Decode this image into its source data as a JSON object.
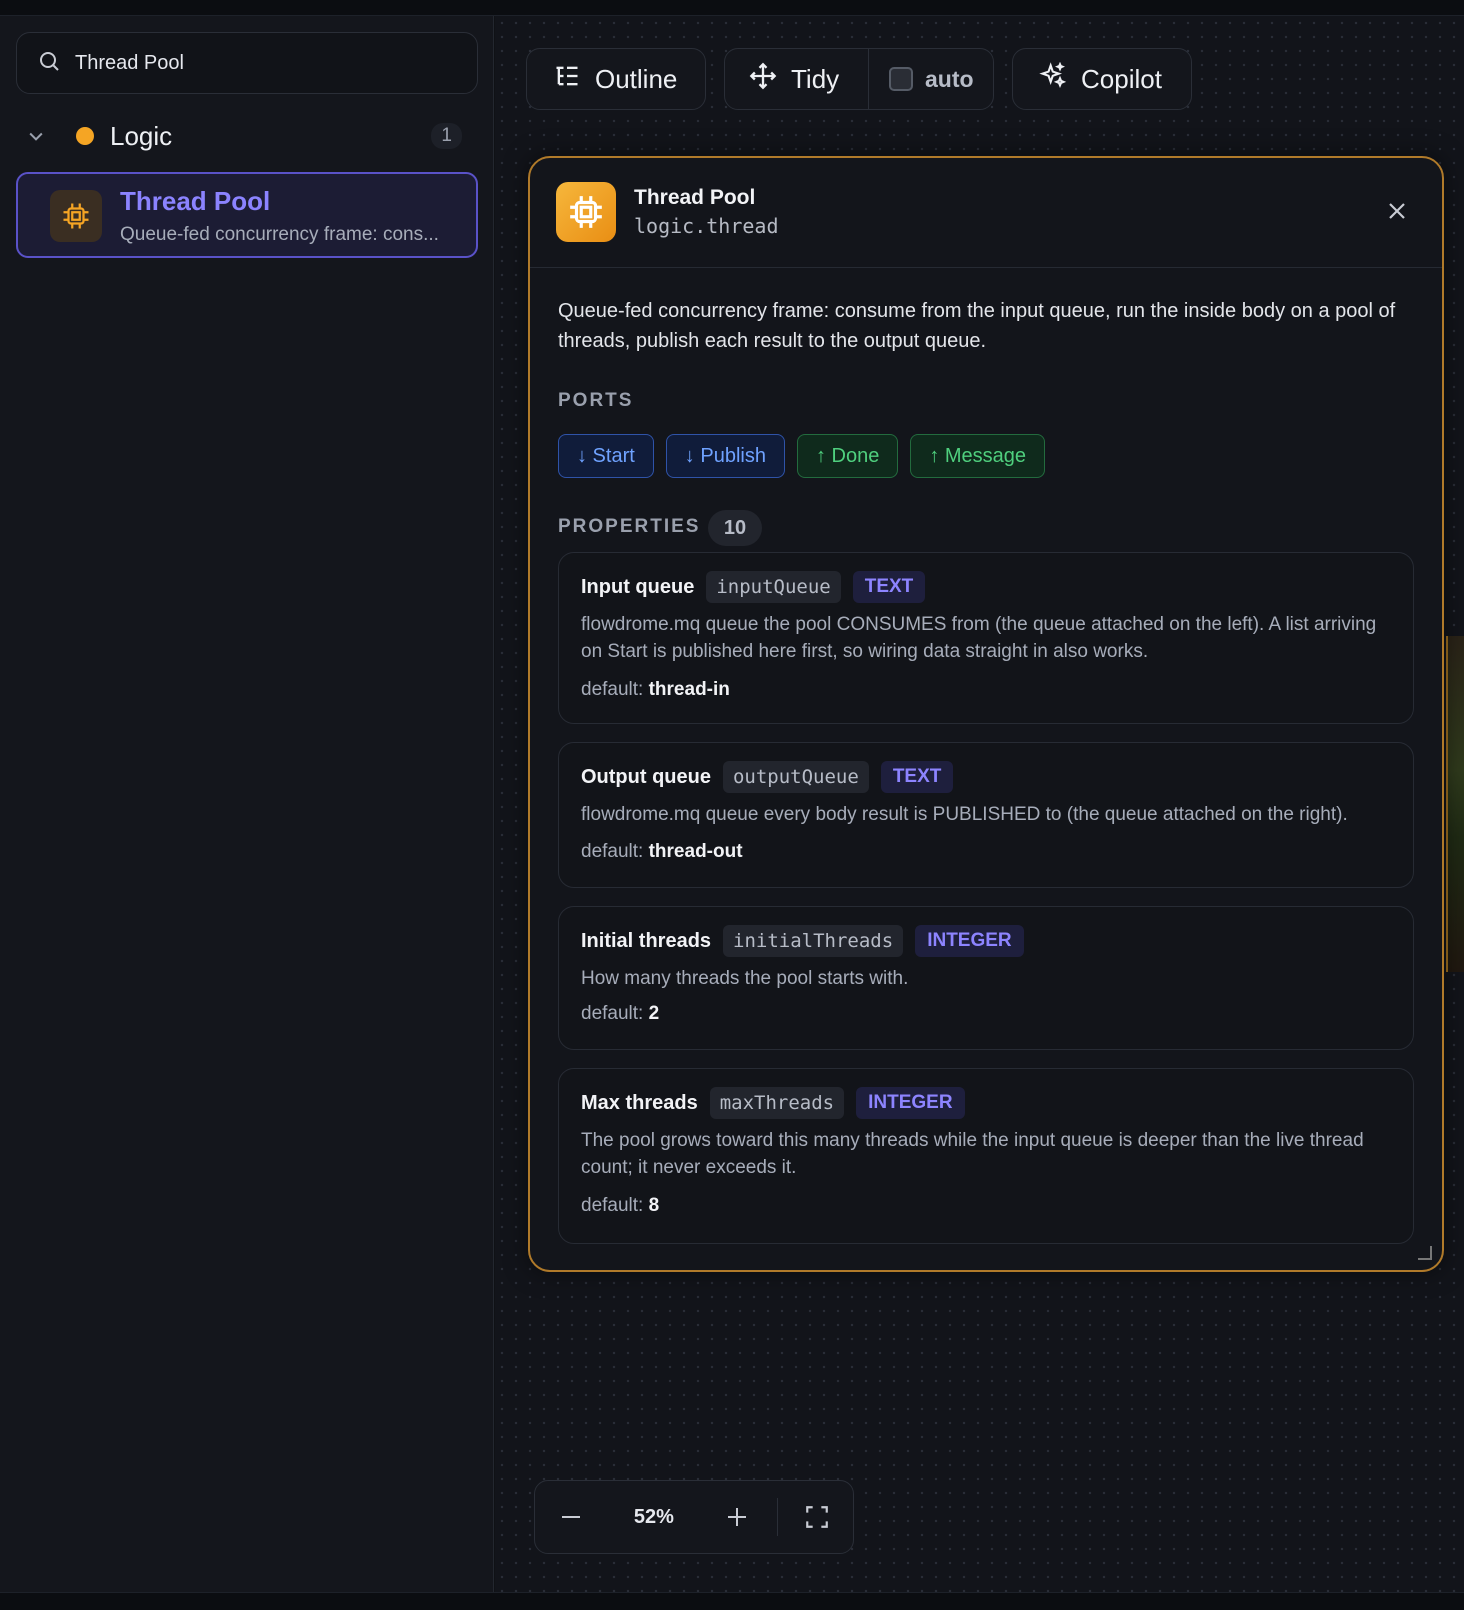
{
  "sidebar": {
    "search": {
      "value": "Thread Pool",
      "icon": "search-icon"
    },
    "group": {
      "label": "Logic",
      "count": "1",
      "dot_color": "#f5a524"
    },
    "item": {
      "title": "Thread Pool",
      "description": "Queue-fed concurrency frame: cons..."
    }
  },
  "toolbar": {
    "outline_label": "Outline",
    "tidy_label": "Tidy",
    "auto_label": "auto",
    "auto_checked": false,
    "copilot_label": "Copilot"
  },
  "panel": {
    "title": "Thread Pool",
    "id": "logic.thread",
    "description": "Queue-fed concurrency frame: consume from the input queue, run the inside body on a pool of threads, publish each result to the output queue.",
    "ports_heading": "PORTS",
    "ports": [
      {
        "label": "↓ Start",
        "direction": "in"
      },
      {
        "label": "↓ Publish",
        "direction": "in"
      },
      {
        "label": "↑ Done",
        "direction": "out"
      },
      {
        "label": "↑ Message",
        "direction": "out"
      }
    ],
    "properties_heading": "PROPERTIES",
    "properties_count": "10",
    "default_label": "default:",
    "properties": [
      {
        "name": "Input queue",
        "key": "inputQueue",
        "type": "TEXT",
        "description": "flowdrome.mq queue the pool CONSUMES from (the queue attached on the left). A list arriving on Start is published here first, so wiring data straight in also works.",
        "default": "thread-in"
      },
      {
        "name": "Output queue",
        "key": "outputQueue",
        "type": "TEXT",
        "description": "flowdrome.mq queue every body result is PUBLISHED to (the queue attached on the right).",
        "default": "thread-out"
      },
      {
        "name": "Initial threads",
        "key": "initialThreads",
        "type": "INTEGER",
        "description": "How many threads the pool starts with.",
        "default": "2"
      },
      {
        "name": "Max threads",
        "key": "maxThreads",
        "type": "INTEGER",
        "description": "The pool grows toward this many threads while the input queue is deeper than the live thread count; it never exceeds it.",
        "default": "8"
      }
    ]
  },
  "zoom": {
    "value": "52%"
  },
  "colors": {
    "accent_purple": "#8b83ff",
    "accent_orange": "#f5a524",
    "port_in": "#6fa2ff",
    "port_out": "#4fcf7e"
  }
}
